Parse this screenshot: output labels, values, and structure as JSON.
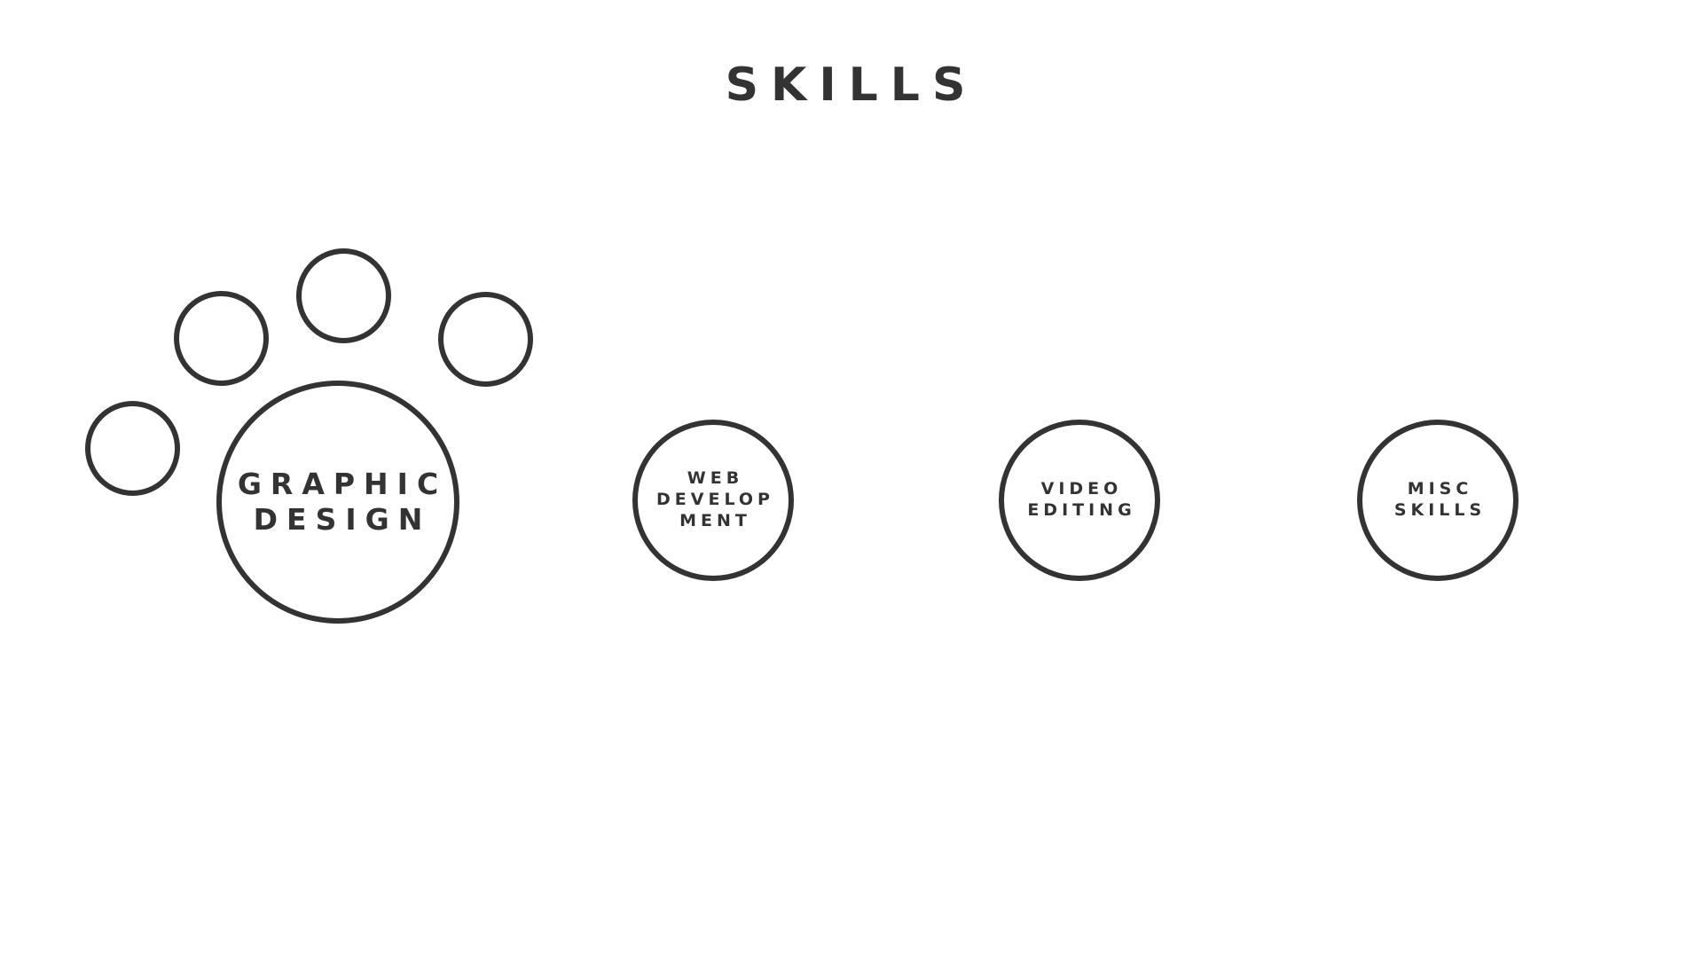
{
  "page": {
    "title": "SKILLS"
  },
  "skills": [
    {
      "label": "GRAPHIC\nDESIGN"
    },
    {
      "label": "WEB\nDEVELOP\nMENT"
    },
    {
      "label": "VIDEO\nEDITING"
    },
    {
      "label": "MISC\nSKILLS"
    }
  ],
  "colors": {
    "stroke": "#333333",
    "background": "#ffffff"
  }
}
